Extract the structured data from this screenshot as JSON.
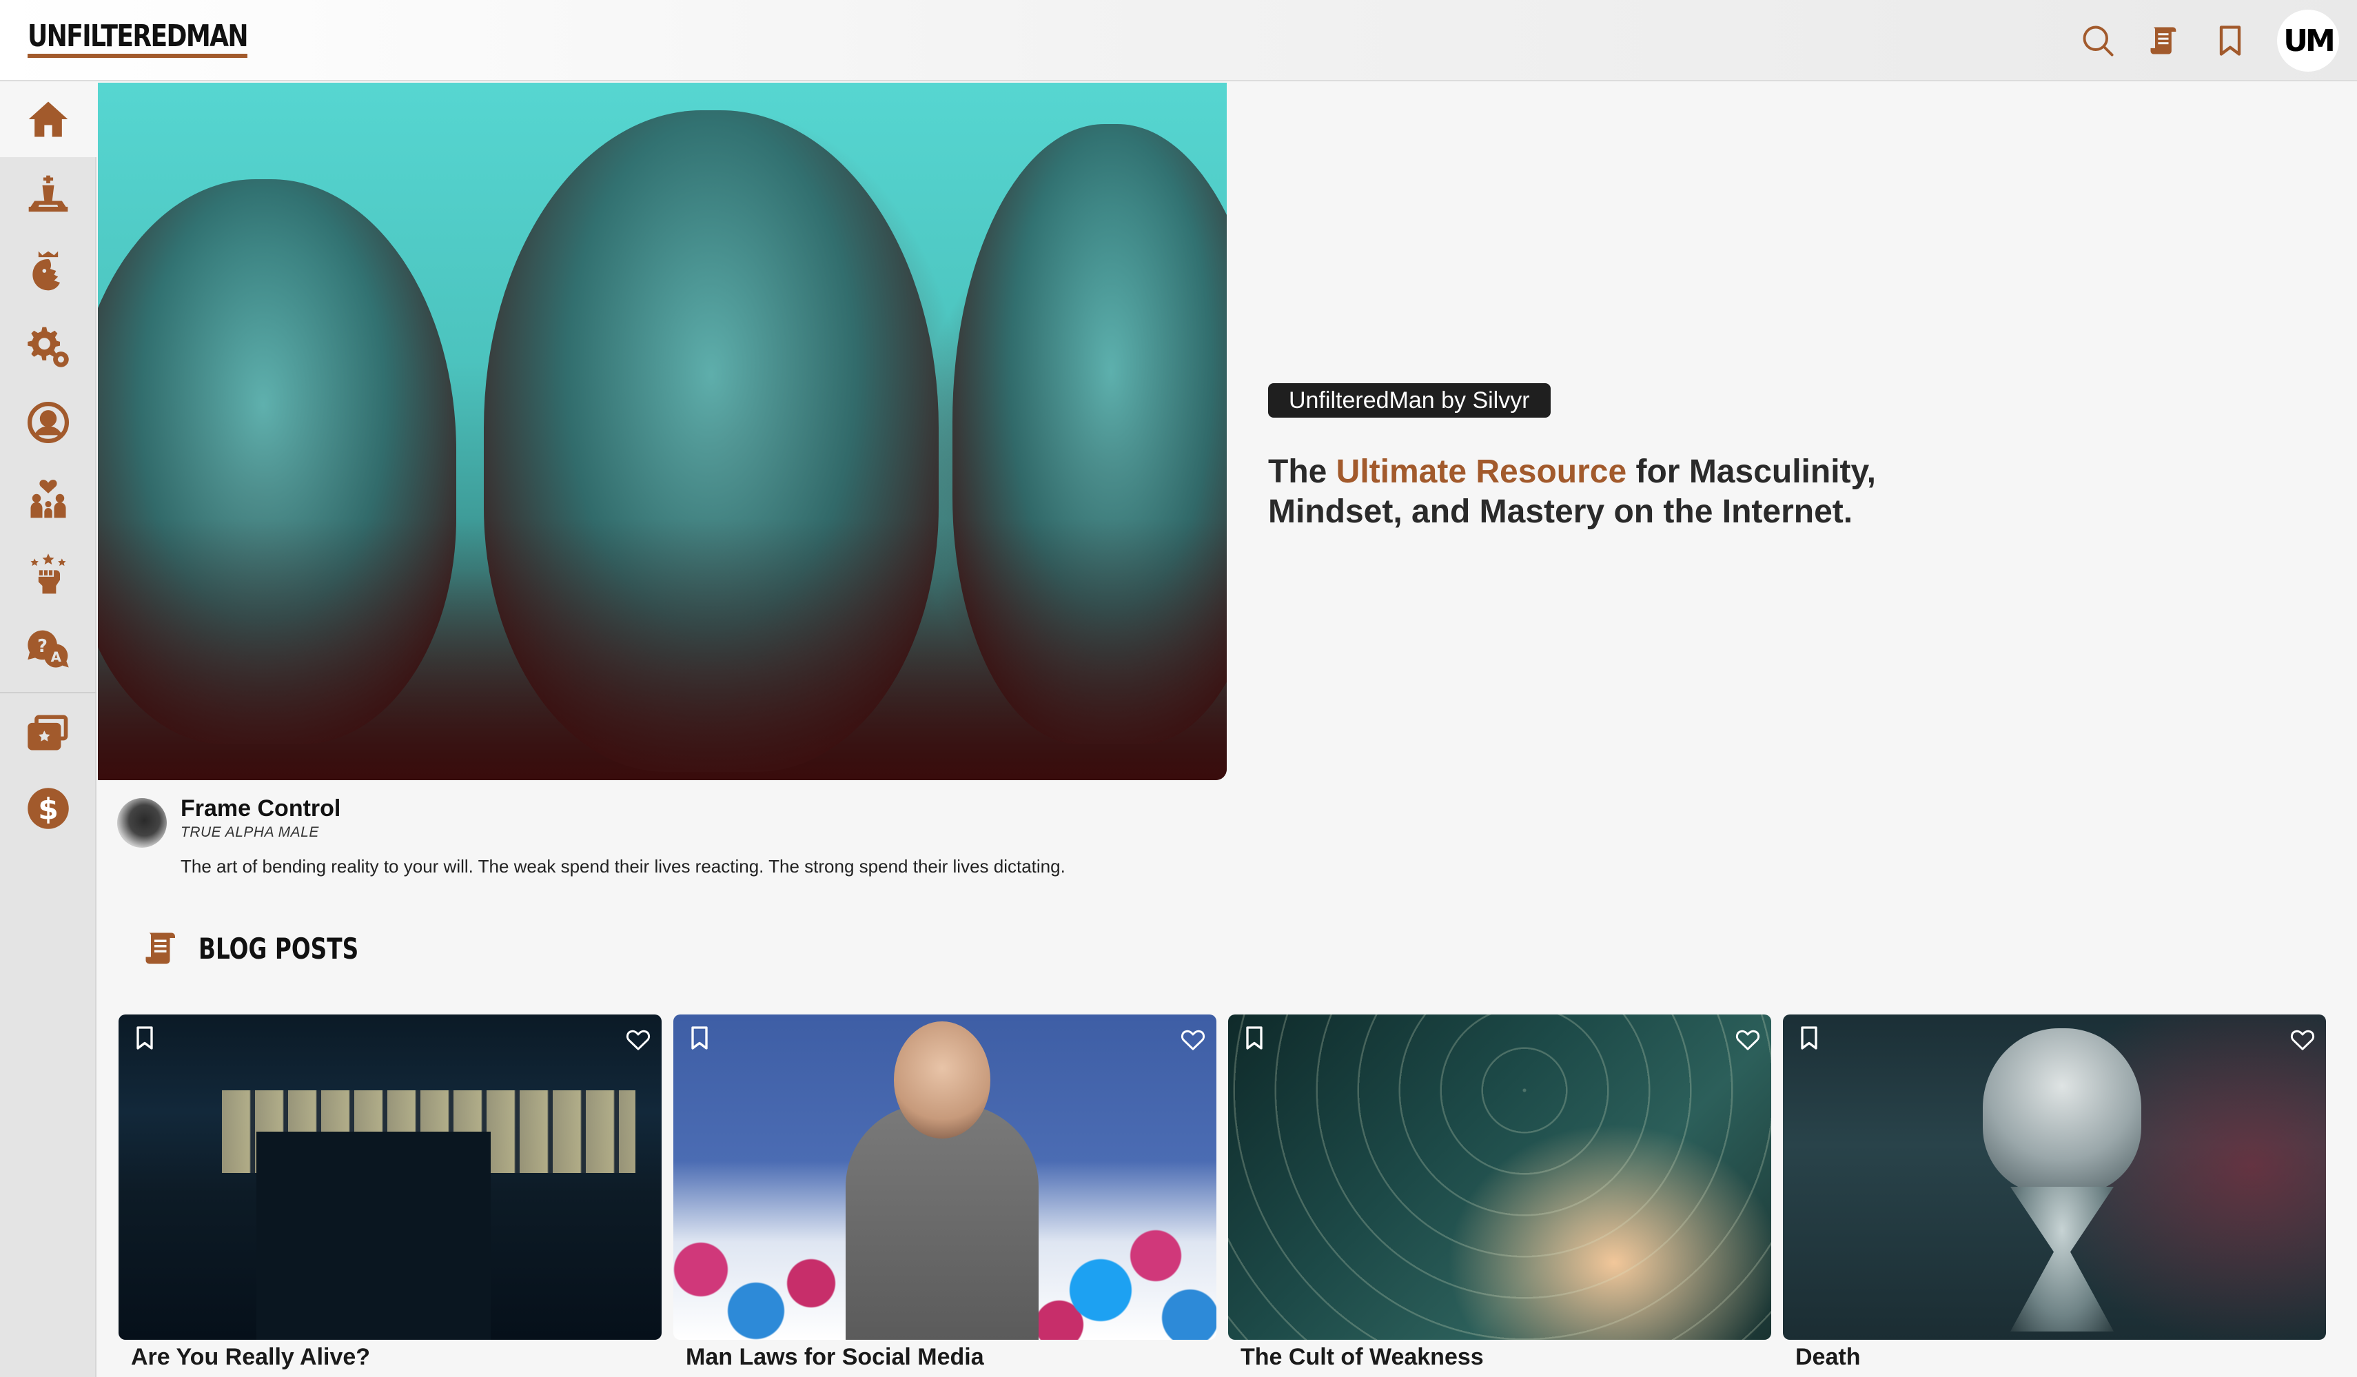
{
  "header": {
    "logo": "UNFILTEREDMAN",
    "icons": [
      "search-icon",
      "scroll-icon",
      "bookmark-icon"
    ],
    "avatar": "UM",
    "accent_color": "#a25a2c"
  },
  "sidebar": {
    "items": [
      {
        "icon": "home-icon",
        "active": true
      },
      {
        "icon": "chess-icon"
      },
      {
        "icon": "lion-crown-icon"
      },
      {
        "icon": "gears-icon"
      },
      {
        "icon": "user-circle-icon"
      },
      {
        "icon": "family-heart-icon"
      },
      {
        "icon": "raised-fist-icon"
      },
      {
        "icon": "question-answer-icon"
      },
      {
        "icon": "ticket-star-icon"
      },
      {
        "icon": "dollar-coin-icon"
      }
    ]
  },
  "hero": {
    "badge": "UnfilteredMan by Silvyr",
    "headline_pre": "The ",
    "headline_accent": "Ultimate Resource",
    "headline_post": " for Masculinity, Mindset, and Mastery on the Internet."
  },
  "featured": {
    "title": "Frame Control",
    "subtitle": "TRUE ALPHA MALE",
    "description": "The art of bending reality to your will. The weak spend their lives reacting. The strong spend their lives dictating."
  },
  "blog": {
    "section_title": "BLOG POSTS",
    "posts": [
      {
        "title": "Are You Really Alive?"
      },
      {
        "title": "Man Laws for Social Media"
      },
      {
        "title": "The Cult of Weakness"
      },
      {
        "title": "Death"
      }
    ]
  }
}
